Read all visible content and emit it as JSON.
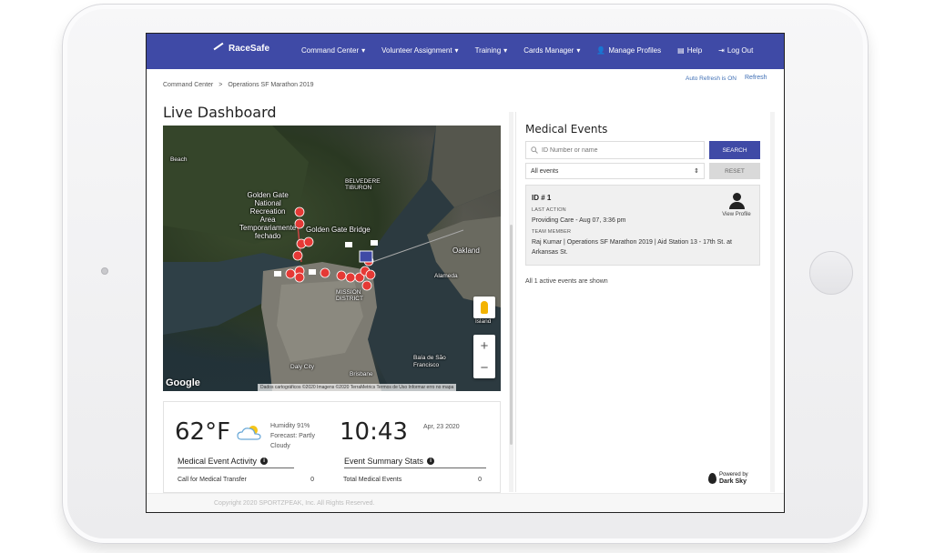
{
  "app": {
    "name": "RaceSafe"
  },
  "nav": {
    "items": [
      {
        "label": "Command Center",
        "caret": true,
        "icon": ""
      },
      {
        "label": "Volunteer Assignment",
        "caret": true,
        "icon": ""
      },
      {
        "label": "Training",
        "caret": true,
        "icon": ""
      },
      {
        "label": "Cards Manager",
        "caret": true,
        "icon": ""
      },
      {
        "label": "Manage Profiles",
        "caret": false,
        "icon": "person-icon"
      },
      {
        "label": "Help",
        "caret": false,
        "icon": "book-icon"
      },
      {
        "label": "Log Out",
        "caret": false,
        "icon": "logout-icon"
      }
    ]
  },
  "breadcrumb": {
    "home": "Command Center",
    "separator": ">",
    "current": "Operations SF Marathon 2019"
  },
  "refresh": {
    "auto": "Auto Refresh is ON",
    "label": "Refresh"
  },
  "page": {
    "title": "Live Dashboard"
  },
  "map": {
    "labels": {
      "ggpark": "Golden Gate\nNational\nRecreation\nArea\nTemporariamente\nfechado",
      "bridge": "Golden Gate Bridge",
      "beach": "Beach",
      "belvedere": "BELVEDERE\nTIBURON",
      "oakland": "Oakland",
      "alameda": "Alameda",
      "mission": "MISSION\nDISTRICT",
      "daly": "Daly City",
      "brisbane": "Brisbane",
      "bay": "Baía de São\nFrancisco",
      "island": "Island"
    },
    "google": "Google",
    "attribution": "Dados cartográficos ©2020 Imagens ©2020 TerraMetrics   Termos de Uso   Informar erro no mapa",
    "zoom_in": "+",
    "zoom_out": "−"
  },
  "weather": {
    "temp": "62°F",
    "humidity": "Humidity 91%",
    "forecast": "Forecast: Partly Cloudy",
    "time": "10:43",
    "date": "Apr, 23 2020"
  },
  "medical_activity": {
    "title": "Medical Event Activity",
    "row_label": "Call for Medical Transfer",
    "row_value": "0"
  },
  "summary_stats": {
    "title": "Event Summary Stats",
    "row_label": "Total Medical Events",
    "row_value": "0"
  },
  "medical_events": {
    "title": "Medical Events",
    "search_placeholder": "ID Number or name",
    "search_label": "SEARCH",
    "filter_selected": "All events",
    "reset_label": "RESET",
    "event": {
      "id": "ID # 1",
      "last_action_label": "LAST ACTION",
      "last_action": "Providing Care - Aug 07, 3:36 pm",
      "team_member_label": "TEAM MEMBER",
      "team_member": "Raj Kumar | Operations SF Marathon 2019 | Aid Station 13 - 17th St. at Arkansas St.",
      "profile_label": "View Profile"
    },
    "shown_text": "All 1 active events are shown",
    "powered_by": "Powered by",
    "powered_name": "Dark Sky"
  },
  "footer": {
    "copyright": "Copyright 2020 SPORTZPEAK, Inc. All Rights Reserved."
  },
  "colors": {
    "nav": "#3f4aa6",
    "marker": "#e53935"
  }
}
